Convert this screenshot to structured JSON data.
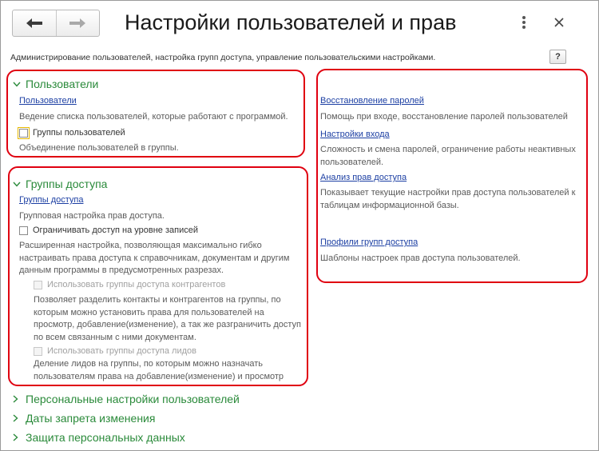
{
  "window": {
    "title": "Настройки пользователей и прав",
    "description": "Администрирование пользователей, настройка групп доступа, управление пользовательскими настройками.",
    "help_label": "?"
  },
  "users_group": {
    "heading": "Пользователи",
    "users_link": "Пользователи",
    "users_note": "Ведение списка пользователей, которые работают с программой.",
    "user_groups_checkbox": "Группы пользователей",
    "user_groups_note": "Объединение пользователей в группы."
  },
  "access_group": {
    "heading": "Группы доступа",
    "access_groups_link": "Группы доступа",
    "access_groups_note": "Групповая настройка прав доступа.",
    "restrict_checkbox": "Ограничивать доступ на уровне записей",
    "restrict_note": "Расширенная настройка, позволяющая максимально гибко настраивать права доступа к справочникам, документам и другим данным программы в предусмотренных разрезах.",
    "counterparty_checkbox": "Использовать группы доступа контрагентов",
    "counterparty_note": "Позволяет разделить контакты и контрагентов на группы, по которым можно установить права для пользователей на просмотр, добавление(изменение), а так же разграничить доступ по всем связанным с ними документам.",
    "leads_checkbox": "Использовать группы доступа лидов",
    "leads_note": "Деление лидов на группы, по которым можно назначать пользователям права на добавление(изменение) и просмотр"
  },
  "right_panel": {
    "password_recovery_link": "Восстановление паролей",
    "password_recovery_note": "Помощь при входе, восстановление паролей пользователей",
    "login_settings_link": "Настройки входа",
    "login_settings_note": "Сложность и смена паролей, ограничение работы неактивных пользователей.",
    "access_analysis_link": "Анализ прав доступа",
    "access_analysis_note": "Показывает текущие настройки прав доступа пользователей к таблицам информационной базы.",
    "profiles_link": "Профили групп доступа",
    "profiles_note": "Шаблоны настроек прав доступа пользователей."
  },
  "collapsed_sections": [
    "Персональные настройки пользователей",
    "Даты запрета изменения",
    "Защита персональных данных"
  ],
  "colors": {
    "section_heading": "#2a8a3a",
    "link": "#1c3fa3",
    "highlight_frame": "#e00010"
  }
}
